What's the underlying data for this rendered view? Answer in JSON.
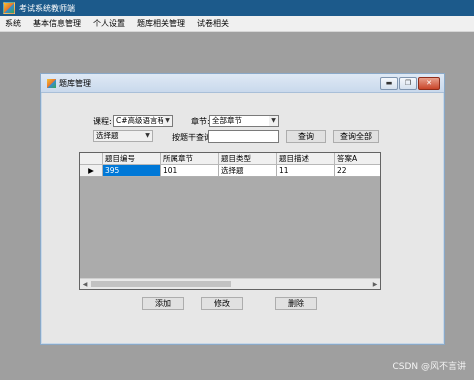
{
  "window": {
    "title": "考试系统教师端"
  },
  "menu": [
    "系统",
    "基本信息管理",
    "个人设置",
    "题库相关管理",
    "试卷相关"
  ],
  "child": {
    "title": "题库管理",
    "buttons": {
      "minimize": "▬",
      "restore": "❐",
      "close": "✕"
    }
  },
  "filters": {
    "course_label": "课程:",
    "course_value": "C#高级语言程序",
    "chapter_label": "章节:",
    "chapter_value": "全部章节",
    "type_value": "选择题",
    "keyword_label": "按题干查询",
    "keyword_value": "",
    "search_button": "查询",
    "search_all_button": "查询全部"
  },
  "grid": {
    "columns": [
      "题目编号",
      "所属章节",
      "题目类型",
      "题目描述",
      "答案A"
    ],
    "rows": [
      {
        "marker": "▶",
        "cells": [
          "395",
          "101",
          "选择题",
          "11",
          "22"
        ]
      }
    ]
  },
  "actions": {
    "add": "添加",
    "edit": "修改",
    "delete": "删除"
  },
  "icons": {
    "app": "app-icon",
    "child": "form-icon",
    "combo_arrow": "chevron-down-icon",
    "row_marker": "current-row-icon",
    "scroll_left": "scroll-left-icon",
    "scroll_right": "scroll-right-icon"
  },
  "watermark": "CSDN @风不言讲"
}
